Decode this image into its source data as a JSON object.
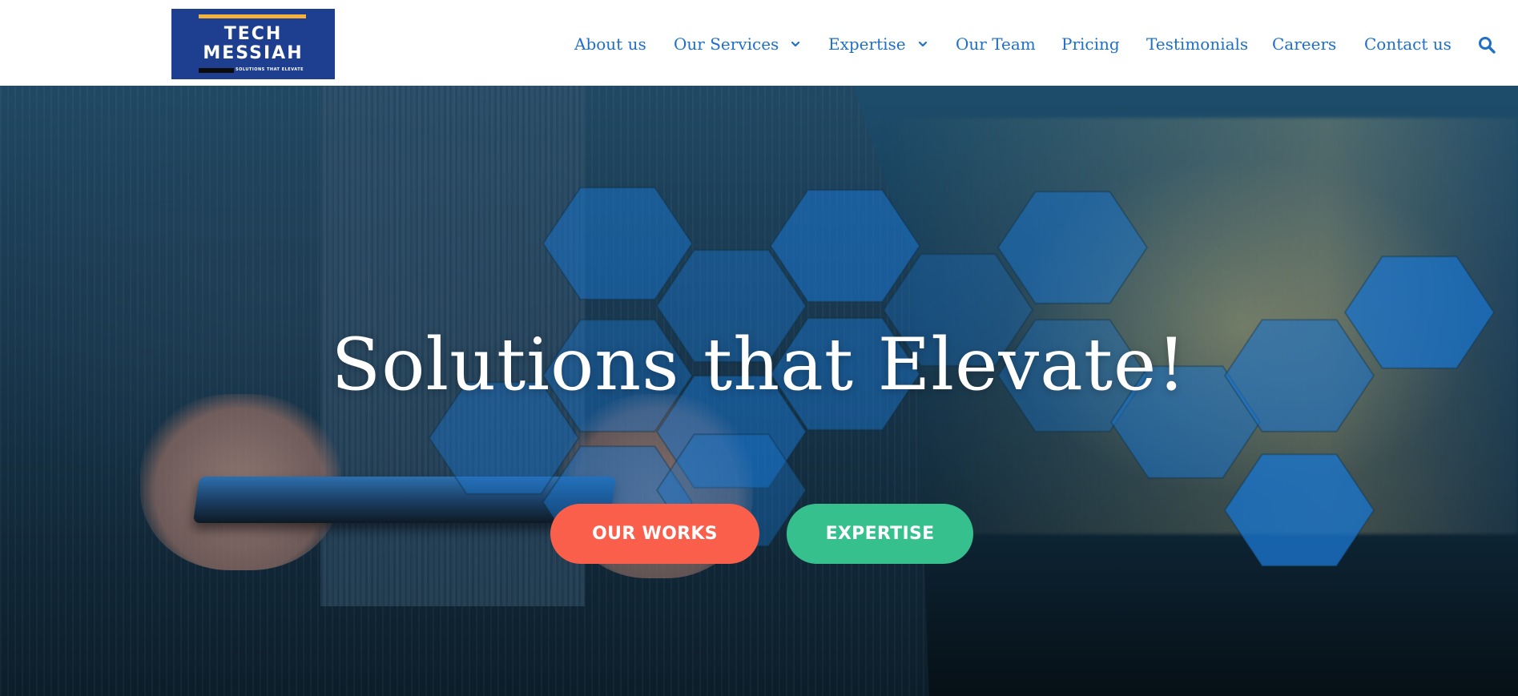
{
  "brand": {
    "logo_line1": "TECH",
    "logo_line2": "MESSIAH",
    "logo_tagline": "SOLUTIONS THAT ELEVATE",
    "logo_bg_color": "#1e3f8f",
    "logo_accent_color": "#f4b23c"
  },
  "nav": {
    "link_color": "#1f6fc9",
    "items": [
      {
        "label": "About us"
      },
      {
        "label": "Our Services",
        "has_dropdown": true,
        "icon": "chevron-down-icon"
      },
      {
        "label": "Expertise",
        "has_dropdown": true,
        "icon": "chevron-down-icon"
      },
      {
        "label": "Our Team"
      },
      {
        "label": "Pricing"
      },
      {
        "label": "Testimonials"
      },
      {
        "label": "Careers"
      },
      {
        "label": "Contact us"
      }
    ],
    "search_icon": "search-icon"
  },
  "hero": {
    "title": "Solutions that Elevate!",
    "buttons": [
      {
        "label": "OUR WORKS",
        "color": "#f95f4b"
      },
      {
        "label": "EXPERTISE",
        "color": "#35c08e"
      }
    ],
    "hex_color": "#1a73c9"
  }
}
